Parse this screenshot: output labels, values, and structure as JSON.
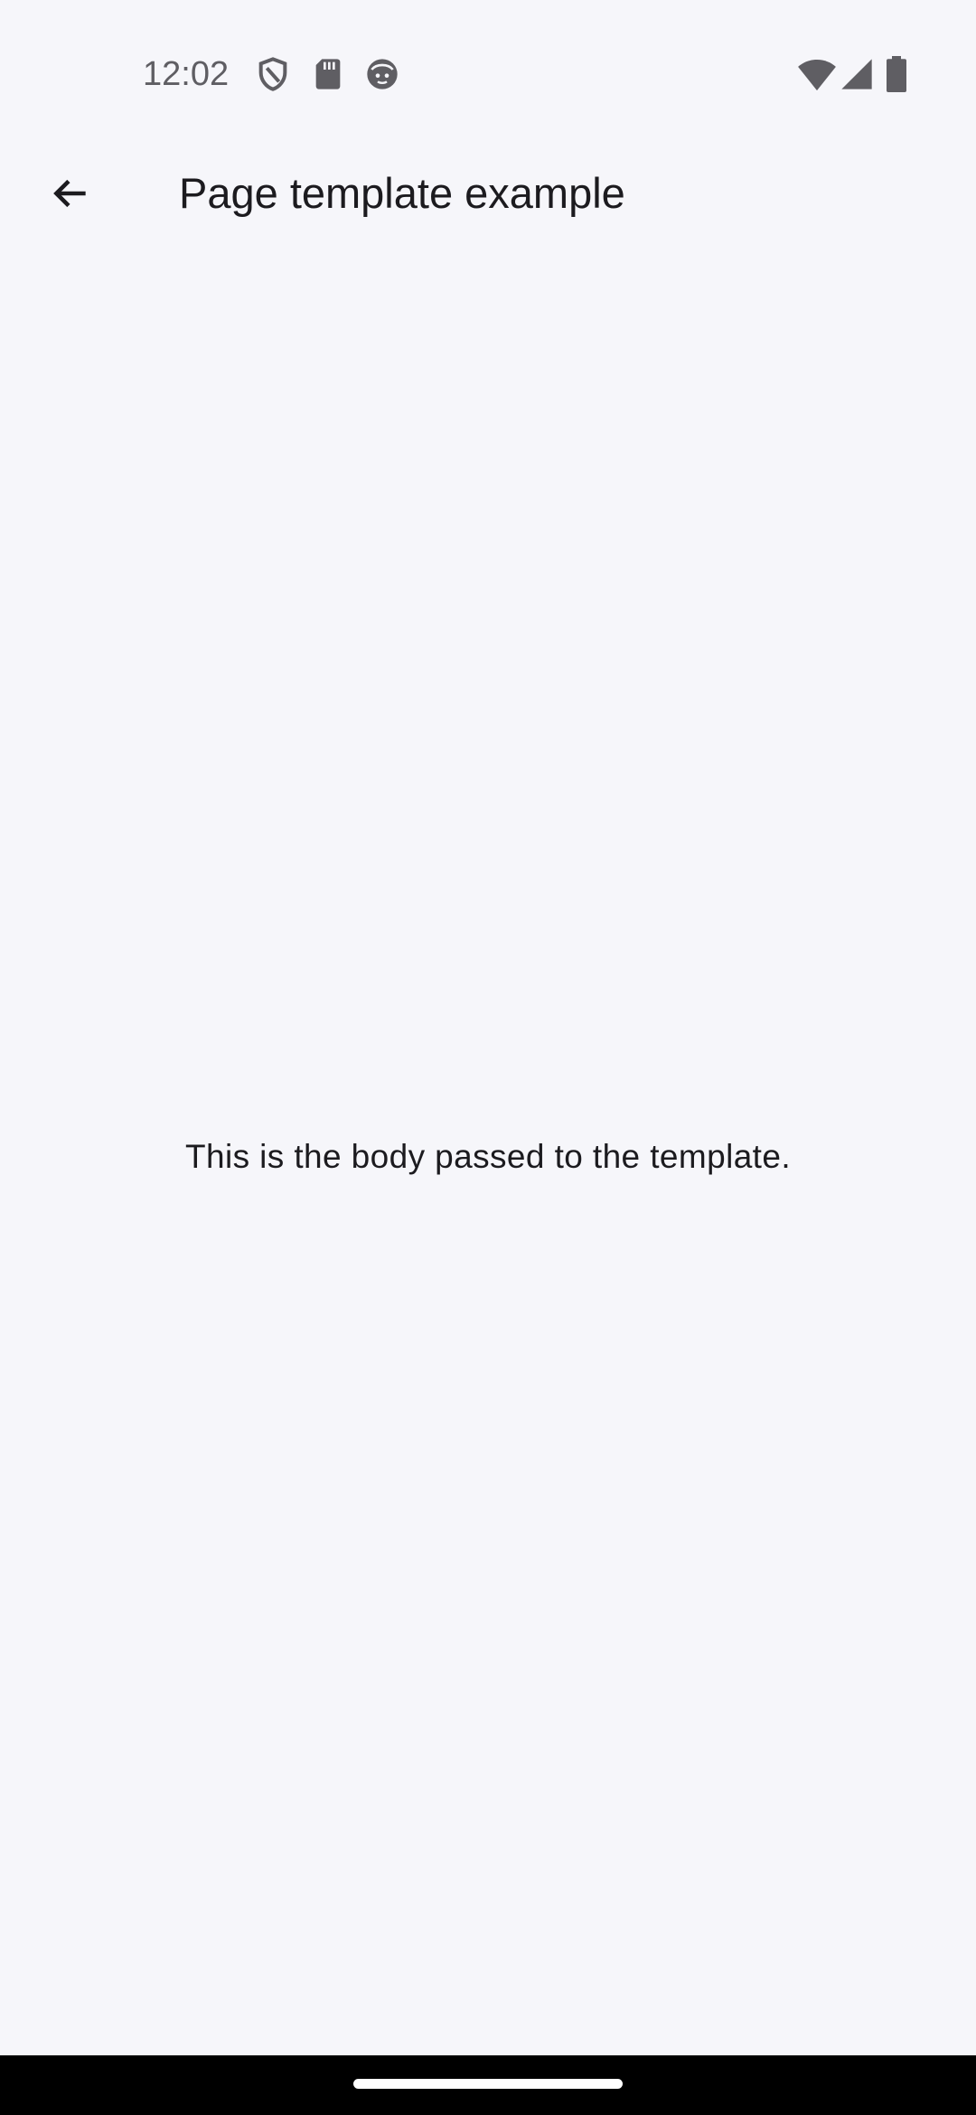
{
  "status_bar": {
    "time": "12:02",
    "left_icons": [
      "shield-icon",
      "sd-card-icon",
      "face-icon"
    ],
    "right_icons": [
      "wifi-icon",
      "cell-signal-icon",
      "battery-icon"
    ]
  },
  "app_bar": {
    "back_icon": "arrow-back-icon",
    "title": "Page template example"
  },
  "body": {
    "text": "This is the body passed to the template."
  },
  "colors": {
    "background": "#f6f6fa",
    "text": "#1c1b1f",
    "status_text": "#5f5e63",
    "nav_bar": "#000000"
  }
}
